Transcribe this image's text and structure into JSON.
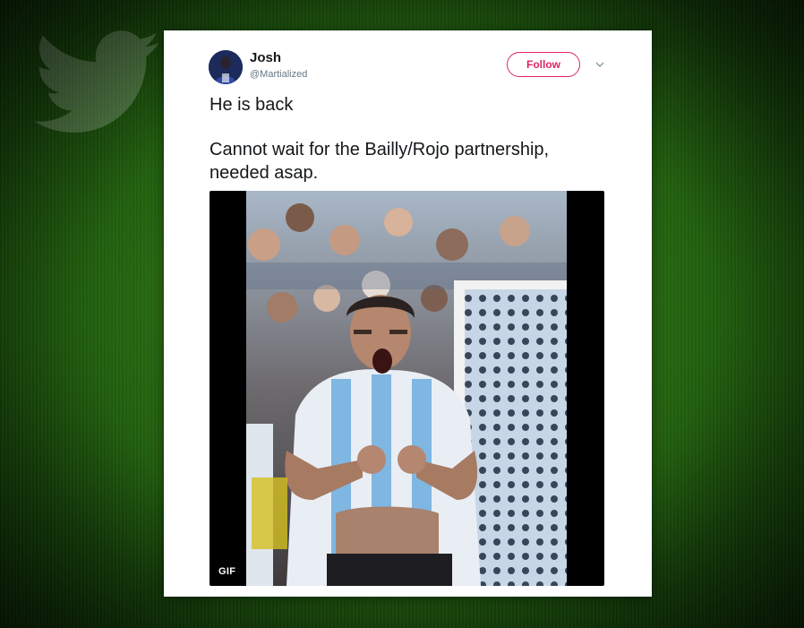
{
  "tweet": {
    "author_name": "Josh",
    "author_handle": "@Martialized",
    "follow_label": "Follow",
    "text_lines": [
      "He is back",
      "Cannot wait for the Bailly/Rojo partnership,",
      "needed asap."
    ]
  },
  "media": {
    "badge": "GIF"
  },
  "colors": {
    "follow_accent": "#e0245e",
    "card_background": "#ffffff",
    "text": "#14171a",
    "handle": "#657786"
  },
  "icons": {
    "background": "twitter-bird-icon",
    "menu": "chevron-down-icon"
  }
}
